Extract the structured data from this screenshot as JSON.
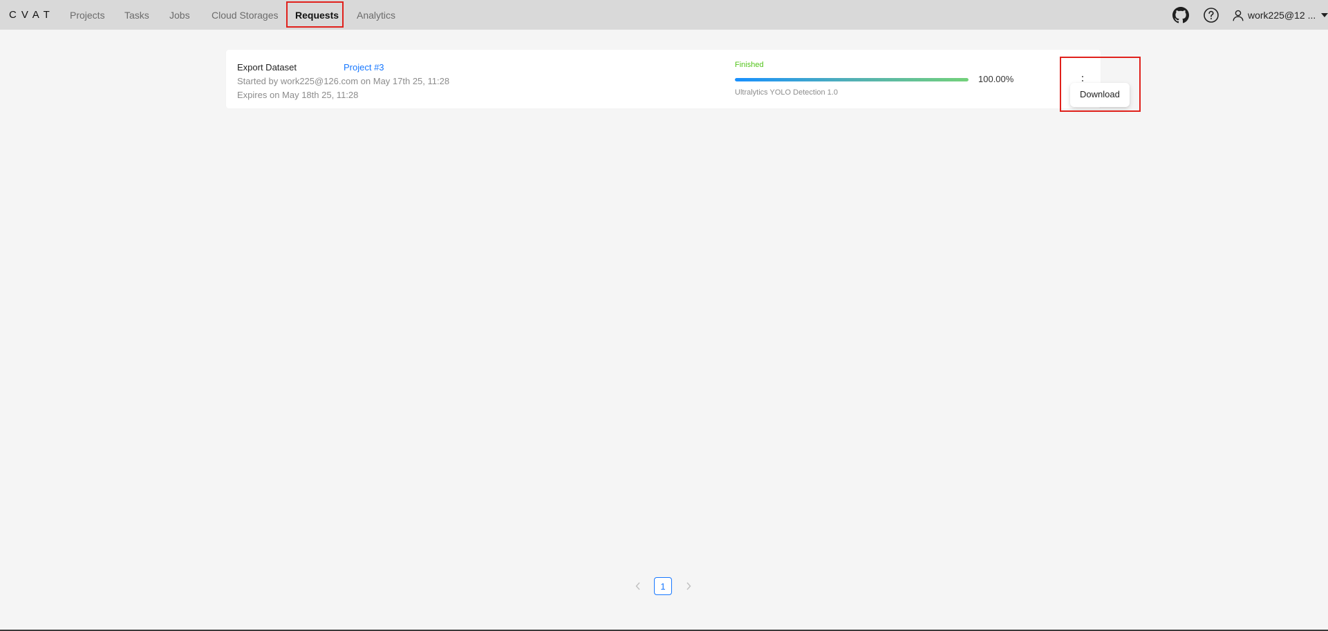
{
  "header": {
    "logo": "CVAT",
    "nav": [
      {
        "label": "Projects"
      },
      {
        "label": "Tasks"
      },
      {
        "label": "Jobs"
      },
      {
        "label": "Cloud Storages"
      },
      {
        "label": "Requests",
        "active": true
      },
      {
        "label": "Analytics"
      }
    ],
    "user": "work225@12 ...",
    "icons": [
      "github-icon",
      "help-icon",
      "user-icon",
      "caret-down-icon"
    ]
  },
  "request_card": {
    "title": "Export Dataset",
    "target_link": "Project #3",
    "started": "Started by work225@126.com on May 17th 25, 11:28",
    "expires": "Expires on May 18th 25, 11:28",
    "status": "Finished",
    "progress_percent": 100,
    "progress_label": "100.00%",
    "format": "Ultralytics YOLO Detection 1.0",
    "menu_icon": "more-vertical-icon",
    "dropdown": {
      "items": [
        {
          "label": "Download"
        }
      ]
    }
  },
  "pagination": {
    "current_page": "1",
    "prev_icon": "chevron-left-icon",
    "next_icon": "chevron-right-icon"
  },
  "colors": {
    "topbar_bg": "#d9d9d9",
    "page_bg": "#f5f5f5",
    "link": "#1677ff",
    "success": "#52c41a",
    "highlight": "#e0201b"
  }
}
